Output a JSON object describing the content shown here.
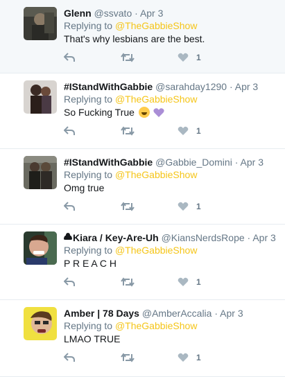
{
  "reply_prefix": "Replying to",
  "accent_color": "#f5c518",
  "tweets": [
    {
      "name": "Glenn",
      "handle": "@ssvato",
      "date": "Apr 3",
      "replying_to": "@TheGabbieShow",
      "text": "That's why lesbians are the best.",
      "like_count": "1",
      "avatar_icon": "avatar-photo"
    },
    {
      "name": "#IStandWithGabbie",
      "handle": "@sarahday1290",
      "date": "Apr 3",
      "replying_to": "@TheGabbieShow",
      "text": "So Fucking True",
      "emojis": [
        "tears-of-joy-emoji",
        "purple-heart-emoji"
      ],
      "like_count": "1",
      "avatar_icon": "avatar-photo"
    },
    {
      "name": "#IStandWithGabbie",
      "handle": "@Gabbie_Domini",
      "date": "Apr 3",
      "replying_to": "@TheGabbieShow",
      "text": "Omg true",
      "like_count": "1",
      "avatar_icon": "avatar-photo"
    },
    {
      "name": "Kiara / Key-Are-Uh",
      "name_prefix_icon": "cloud-icon",
      "handle": "@KiansNerdsRope",
      "date": "Apr 3",
      "replying_to": "@TheGabbieShow",
      "text": "P R E A C H",
      "like_count": "1",
      "avatar_icon": "avatar-photo"
    },
    {
      "name": "Amber | 78 Days",
      "handle": "@AmberAccalia",
      "date": "Apr 3",
      "replying_to": "@TheGabbieShow",
      "text": "LMAO TRUE",
      "like_count": "1",
      "avatar_icon": "avatar-photo"
    }
  ],
  "separator": "·"
}
